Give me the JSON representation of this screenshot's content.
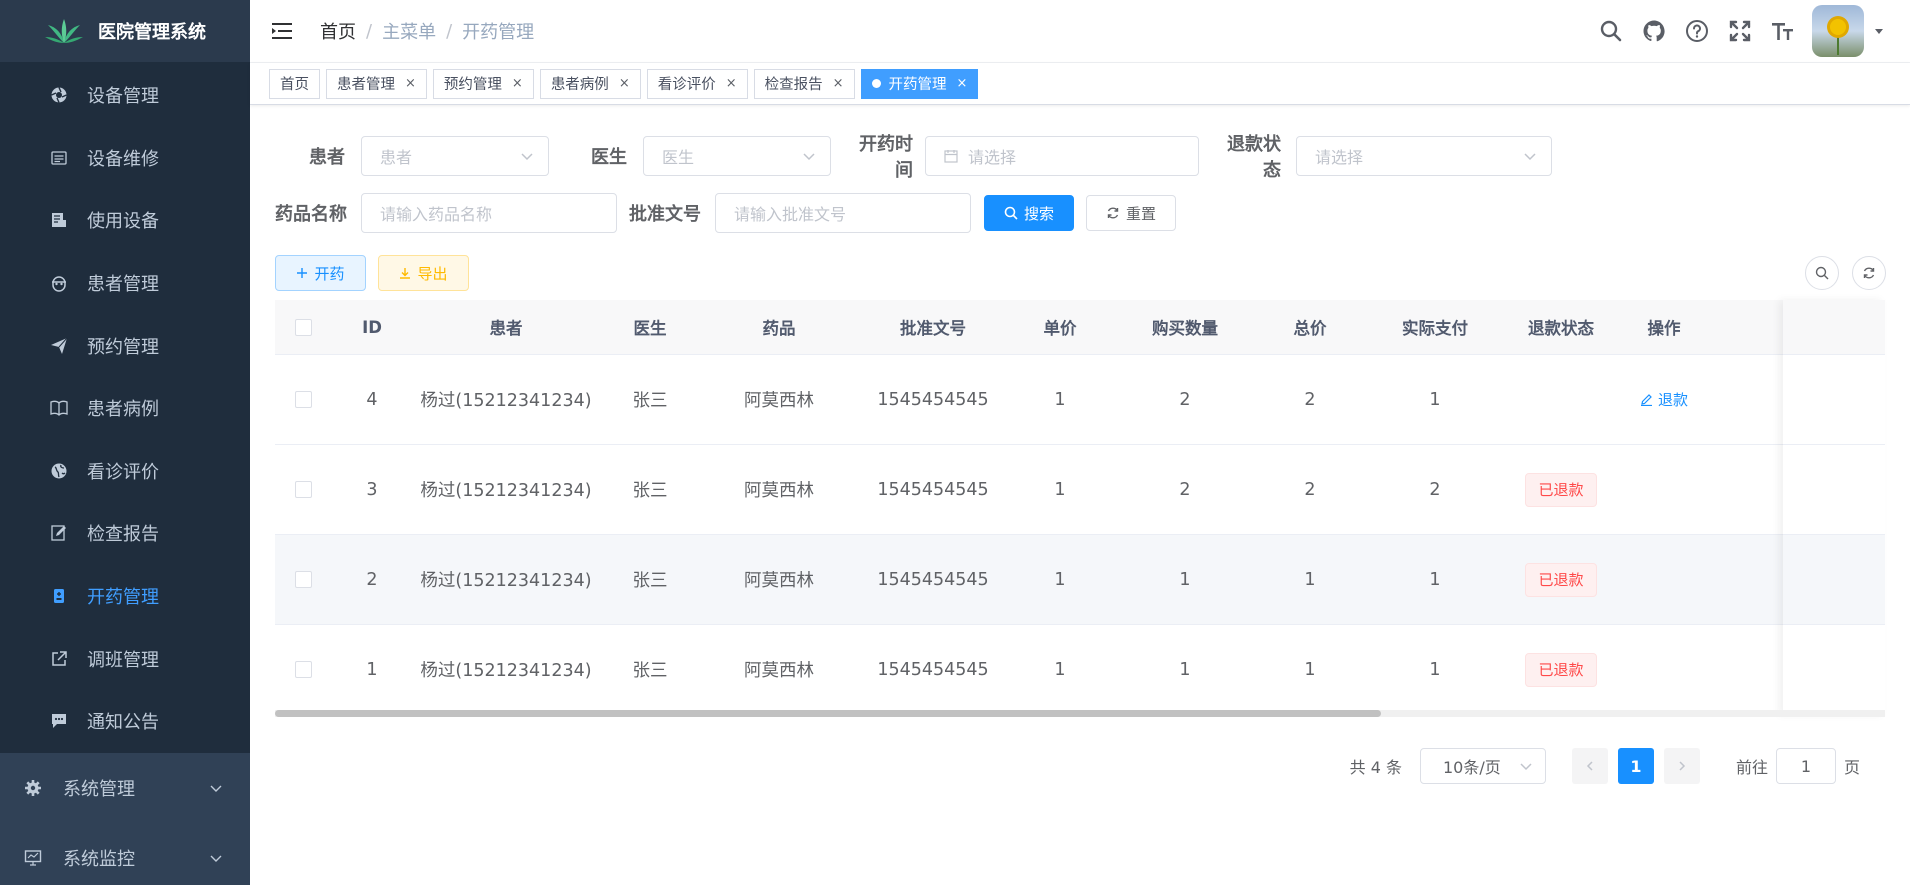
{
  "app": {
    "title": "医院管理系统"
  },
  "sidebar": {
    "items": [
      {
        "label": "设备管理",
        "icon": "aperture-icon"
      },
      {
        "label": "设备维修",
        "icon": "list-icon"
      },
      {
        "label": "使用设备",
        "icon": "document-icon"
      },
      {
        "label": "患者管理",
        "icon": "peoples-icon"
      },
      {
        "label": "预约管理",
        "icon": "send-icon"
      },
      {
        "label": "患者病例",
        "icon": "book-icon"
      },
      {
        "label": "看诊评价",
        "icon": "globe-icon"
      },
      {
        "label": "检查报告",
        "icon": "edit-icon"
      },
      {
        "label": "开药管理",
        "icon": "pill-icon",
        "active": true
      },
      {
        "label": "调班管理",
        "icon": "external-link-icon"
      },
      {
        "label": "通知公告",
        "icon": "message-icon"
      }
    ],
    "groups": [
      {
        "label": "系统管理",
        "icon": "gear-icon"
      },
      {
        "label": "系统监控",
        "icon": "monitor-icon"
      }
    ]
  },
  "header": {
    "breadcrumb": [
      "首页",
      "主菜单",
      "开药管理"
    ],
    "tools": [
      "search-icon",
      "github-icon",
      "question-icon",
      "fullscreen-icon",
      "font-size-icon"
    ]
  },
  "tags": [
    {
      "label": "首页",
      "closable": false
    },
    {
      "label": "患者管理",
      "closable": true
    },
    {
      "label": "预约管理",
      "closable": true
    },
    {
      "label": "患者病例",
      "closable": true
    },
    {
      "label": "看诊评价",
      "closable": true
    },
    {
      "label": "检查报告",
      "closable": true
    },
    {
      "label": "开药管理",
      "closable": true,
      "active": true
    }
  ],
  "filters": {
    "patient": {
      "label": "患者",
      "placeholder": "患者"
    },
    "doctor": {
      "label": "医生",
      "placeholder": "医生"
    },
    "time": {
      "label": "开药时间",
      "placeholder": "请选择"
    },
    "refund": {
      "label": "退款状态",
      "placeholder": "请选择"
    },
    "drug": {
      "label": "药品名称",
      "placeholder": "请输入药品名称"
    },
    "approval": {
      "label": "批准文号",
      "placeholder": "请输入批准文号"
    },
    "search_btn": "搜索",
    "reset_btn": "重置"
  },
  "toolbar": {
    "add_btn": "开药",
    "export_btn": "导出"
  },
  "table": {
    "columns": [
      "ID",
      "患者",
      "医生",
      "药品",
      "批准文号",
      "单价",
      "购买数量",
      "总价",
      "实际支付",
      "退款状态",
      "操作"
    ],
    "rows": [
      {
        "id": "4",
        "patient": "杨过(15212341234)",
        "doctor": "张三",
        "drug": "阿莫西林",
        "approval": "1545454545",
        "price": "1",
        "qty": "2",
        "total": "2",
        "paid": "1",
        "status": "",
        "action": "退款"
      },
      {
        "id": "3",
        "patient": "杨过(15212341234)",
        "doctor": "张三",
        "drug": "阿莫西林",
        "approval": "1545454545",
        "price": "1",
        "qty": "2",
        "total": "2",
        "paid": "2",
        "status": "已退款",
        "action": ""
      },
      {
        "id": "2",
        "patient": "杨过(15212341234)",
        "doctor": "张三",
        "drug": "阿莫西林",
        "approval": "1545454545",
        "price": "1",
        "qty": "1",
        "total": "1",
        "paid": "1",
        "status": "已退款",
        "action": ""
      },
      {
        "id": "1",
        "patient": "杨过(15212341234)",
        "doctor": "张三",
        "drug": "阿莫西林",
        "approval": "1545454545",
        "price": "1",
        "qty": "1",
        "total": "1",
        "paid": "1",
        "status": "已退款",
        "action": ""
      }
    ]
  },
  "pagination": {
    "total_text": "共 4 条",
    "page_size": "10条/页",
    "current": "1",
    "goto_prefix": "前往",
    "goto_value": "1",
    "goto_suffix": "页"
  },
  "colors": {
    "sidebar_bg": "#304156",
    "accent": "#1890ff",
    "danger": "#ff4949"
  }
}
